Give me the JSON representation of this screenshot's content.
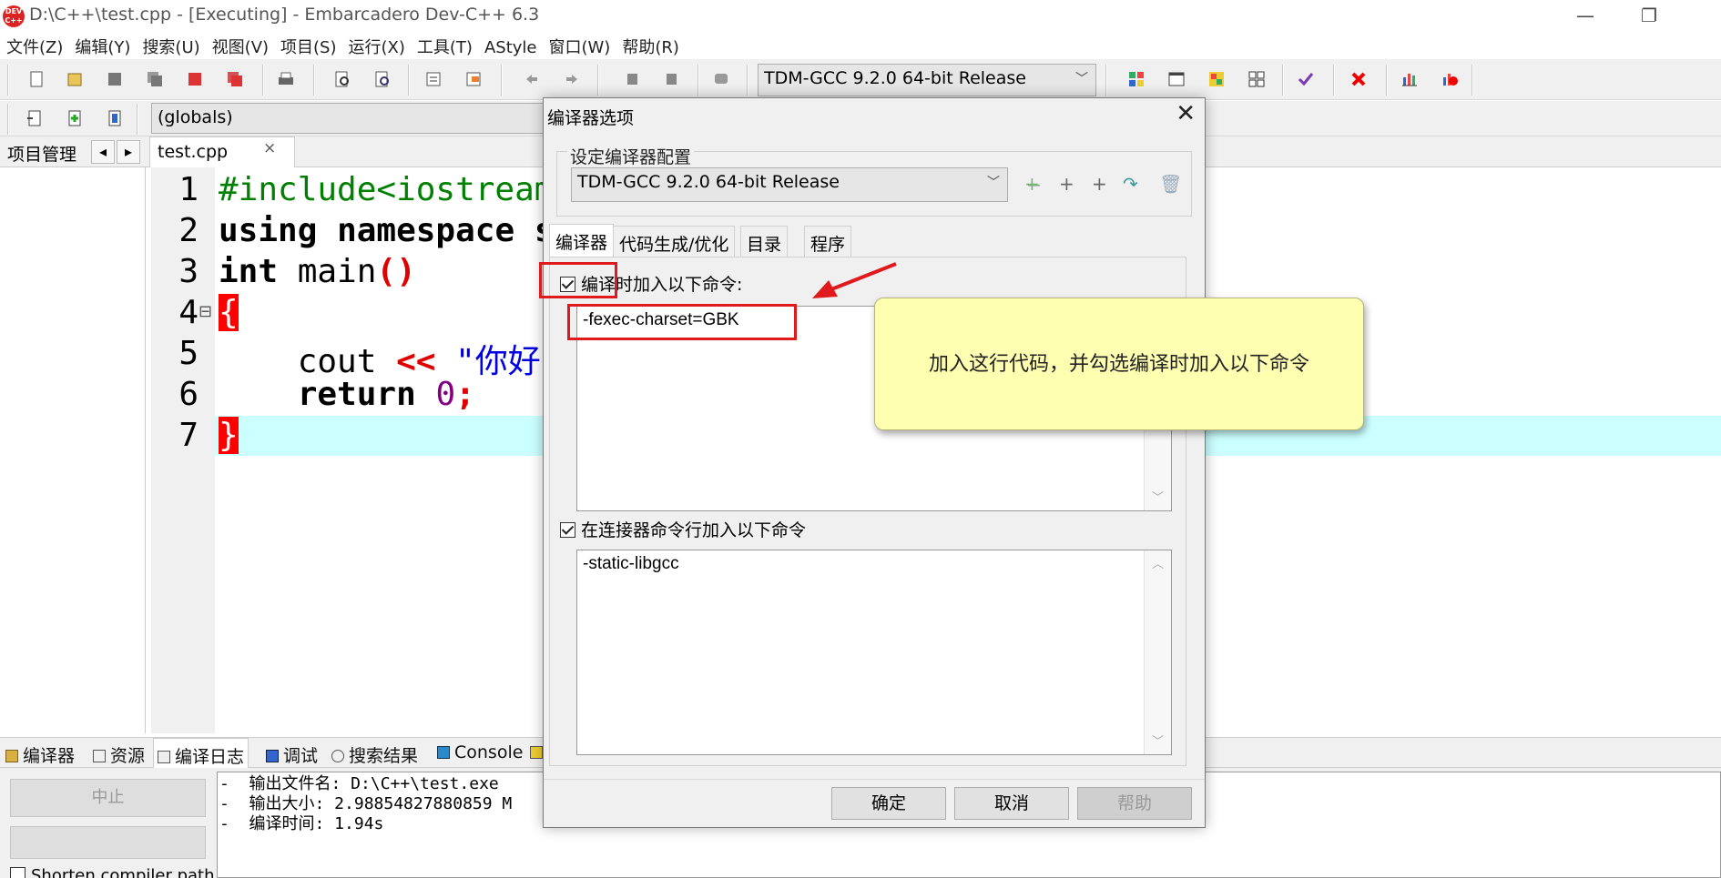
{
  "window": {
    "title": "D:\\C++\\test.cpp - [Executing] - Embarcadero Dev-C++ 6.3",
    "app_icon_text": "DEV C++"
  },
  "menu": [
    "文件(Z)",
    "编辑(Y)",
    "搜索(U)",
    "视图(V)",
    "项目(S)",
    "运行(X)",
    "工具(T)",
    "AStyle",
    "窗口(W)",
    "帮助(R)"
  ],
  "toolbar": {
    "compiler_select": "TDM-GCC 9.2.0 64-bit Release",
    "scope_select": "(globals)"
  },
  "project_panel": {
    "tab_label": "项目管理",
    "prev_arrow": "◂",
    "next_arrow": "▸"
  },
  "editor": {
    "tab_label": "test.cpp",
    "tab_close": "×",
    "line_numbers": [
      "1",
      "2",
      "3",
      "4",
      "5",
      "6",
      "7"
    ],
    "fold_marker": "⊟",
    "lines": {
      "l1": "#include<iostream",
      "l2_kw1": "using",
      "l2_kw2": "namespace",
      "l2_rest": " s",
      "l3_kw": "int",
      "l3_name": " main",
      "l3_parens": "()",
      "l4": "{",
      "l5_ident": "    cout ",
      "l5_op": "<<",
      "l5_str": " \"你好",
      "l6_kw": "    return",
      "l6_num": "0",
      "l6_semi": ";",
      "l7": "}"
    },
    "current_line_color": "#ccffff"
  },
  "bottom_panel": {
    "tabs": [
      "编译器",
      "资源",
      "编译日志",
      "调试",
      "搜索结果",
      "Console"
    ],
    "stop_button": "中止",
    "log_lines": [
      "-  输出文件名: D:\\C++\\test.exe",
      "-  输出大小: 2.98854827880859 M",
      "-  编译时间: 1.94s"
    ],
    "shorten_label": "Shorten compiler path"
  },
  "dialog": {
    "title": "编译器选项",
    "close": "✕",
    "config_label": "设定编译器配置",
    "config_value": "TDM-GCC 9.2.0 64-bit Release",
    "tabs": [
      "编译器",
      "代码生成/优化",
      "目录",
      "程序"
    ],
    "compile_check_label": "编译时加入以下命令:",
    "compile_check_checked": true,
    "compile_commands": "-fexec-charset=GBK",
    "linker_check_label": "在连接器命令行加入以下命令",
    "linker_check_checked": true,
    "linker_commands": "-static-libgcc",
    "ok": "确定",
    "cancel": "取消",
    "help": "帮助"
  },
  "annotation": {
    "callout_text": "加入这行代码，并勾选编译时加入以下命令",
    "highlight_color": "#e0191c"
  }
}
